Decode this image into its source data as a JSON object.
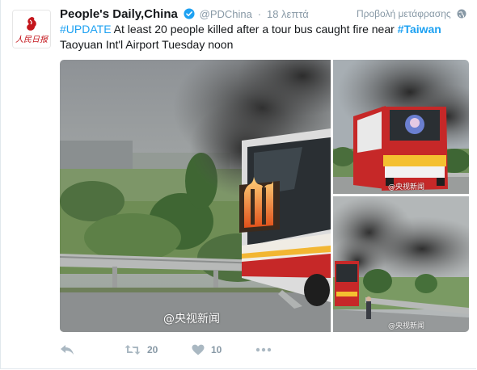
{
  "tweet": {
    "account_name": "People's Daily,China",
    "handle": "@PDChina",
    "separator": "·",
    "time": "18 λεπτά",
    "translate_label": "Προβολή μετάφρασης",
    "text": {
      "hashtag_update": "#UPDATE",
      "part1": " At least 20 people killed after a tour bus caught fire near ",
      "hashtag_taiwan": "#Taiwan",
      "part2": "Taoyuan Int'l Airport Tuesday noon"
    },
    "avatar_logo_text": "人民日报",
    "media": {
      "watermark": "@央视新闻",
      "photos": [
        "bus-fire-main",
        "bus-rear-smoke",
        "bus-smoke-roadside"
      ]
    },
    "actions": {
      "reply_icon": "reply-icon",
      "retweet_icon": "retweet-icon",
      "retweet_count": "20",
      "like_icon": "heart-icon",
      "like_count": "10",
      "more_icon": "more-icon"
    }
  },
  "colors": {
    "link": "#1da1f2",
    "muted": "#8899a6",
    "text": "#14171a",
    "brand_red": "#c4161c"
  }
}
